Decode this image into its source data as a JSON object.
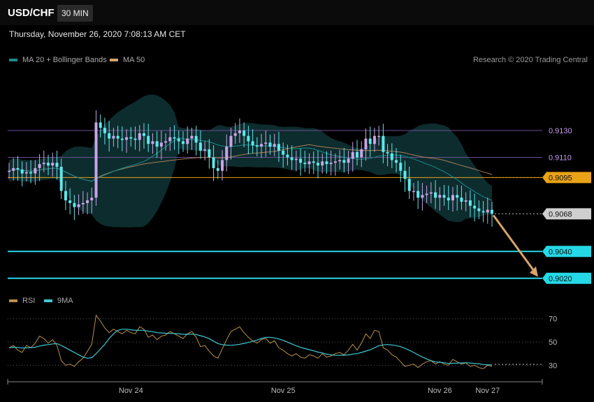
{
  "header": {
    "symbol": "USD/CHF",
    "timeframe": "30 MIN",
    "timestamp": "Thursday, November 26, 2020 7:08:13 AM CET"
  },
  "copyright": "Research © 2020 Trading Central",
  "colors": {
    "up": "#c9a5e6",
    "down": "#5ee8ec",
    "ma20": "#1a8a8c",
    "ma50": "#b8875a",
    "band_fill": "#0f3436",
    "resistance": "#6a4f93",
    "pivot": "#e8a317",
    "support": "#25d8e6",
    "arrow": "#d9a36a",
    "rsi": "#b88f4a",
    "rsi_ma": "#3fc9d6"
  },
  "chart_data": [
    {
      "type": "candlestick",
      "title": "USD/CHF",
      "legend": [
        {
          "name": "MA 20 + Bollinger Bands",
          "color": "#1a8a8c"
        },
        {
          "name": "MA 50",
          "color": "#d9a36a"
        }
      ],
      "legend_position": "top-left",
      "ylim": [
        0.901,
        0.917
      ],
      "x_ticks": [
        {
          "label": "Nov 24",
          "index": 28
        },
        {
          "label": "Nov 25",
          "index": 63
        },
        {
          "label": "Nov 26",
          "index": 99
        },
        {
          "label": "Nov 27",
          "index": 110
        }
      ],
      "levels": [
        {
          "label": "0.9130",
          "value": 0.913,
          "kind": "resistance"
        },
        {
          "label": "0.9110",
          "value": 0.911,
          "kind": "resistance"
        },
        {
          "label": "0.9095",
          "value": 0.9095,
          "kind": "pivot"
        },
        {
          "label": "0.9068",
          "value": 0.9068,
          "kind": "last"
        },
        {
          "label": "0.9040",
          "value": 0.904,
          "kind": "support"
        },
        {
          "label": "0.9020",
          "value": 0.902,
          "kind": "support"
        }
      ],
      "forecast_arrow": {
        "from": 0.9068,
        "to": 0.902
      },
      "close": [
        0.91,
        0.9102,
        0.9101,
        0.9098,
        0.9099,
        0.9098,
        0.9102,
        0.9105,
        0.9106,
        0.9104,
        0.9106,
        0.9103,
        0.9085,
        0.9078,
        0.9076,
        0.9073,
        0.9075,
        0.9076,
        0.9078,
        0.908,
        0.9136,
        0.9132,
        0.9128,
        0.9124,
        0.9126,
        0.9124,
        0.9123,
        0.9125,
        0.9124,
        0.9123,
        0.9128,
        0.9126,
        0.912,
        0.9122,
        0.9118,
        0.9121,
        0.9122,
        0.9125,
        0.9124,
        0.9122,
        0.912,
        0.9124,
        0.9126,
        0.9121,
        0.9115,
        0.9116,
        0.911,
        0.9102,
        0.91,
        0.9108,
        0.9118,
        0.9126,
        0.9128,
        0.913,
        0.9126,
        0.9122,
        0.9119,
        0.9118,
        0.912,
        0.9121,
        0.9118,
        0.912,
        0.9115,
        0.9112,
        0.911,
        0.9108,
        0.9109,
        0.9106,
        0.9105,
        0.9107,
        0.9106,
        0.9104,
        0.9107,
        0.9105,
        0.9106,
        0.9107,
        0.9108,
        0.9106,
        0.9109,
        0.9114,
        0.911,
        0.9116,
        0.9124,
        0.912,
        0.9126,
        0.9126,
        0.9114,
        0.9113,
        0.9108,
        0.9106,
        0.91,
        0.9094,
        0.9085,
        0.9085,
        0.908,
        0.9082,
        0.9083,
        0.9084,
        0.908,
        0.9082,
        0.908,
        0.9078,
        0.9082,
        0.908,
        0.9077,
        0.9078,
        0.9074,
        0.9072,
        0.907,
        0.9069,
        0.9071,
        0.9068
      ],
      "rsi": {
        "ylim": [
          20,
          80
        ],
        "y_ticks": [
          "70",
          "50",
          "30"
        ],
        "legend": [
          {
            "name": "RSI",
            "color": "#b88f4a"
          },
          {
            "name": "9MA",
            "color": "#3fc9d6"
          }
        ],
        "rsi": [
          45,
          47,
          43,
          41,
          47,
          45,
          49,
          55,
          53,
          49,
          52,
          47,
          34,
          30,
          31,
          29,
          33,
          36,
          42,
          48,
          73,
          68,
          62,
          58,
          61,
          59,
          57,
          60,
          58,
          57,
          63,
          61,
          54,
          56,
          52,
          55,
          56,
          59,
          57,
          55,
          53,
          57,
          59,
          54,
          46,
          47,
          42,
          38,
          36,
          44,
          52,
          59,
          61,
          63,
          58,
          54,
          51,
          49,
          52,
          53,
          49,
          51,
          45,
          43,
          40,
          38,
          40,
          37,
          36,
          39,
          38,
          36,
          40,
          37,
          38,
          40,
          41,
          39,
          43,
          48,
          43,
          49,
          57,
          53,
          60,
          59,
          45,
          43,
          39,
          37,
          33,
          29,
          30,
          31,
          28,
          31,
          33,
          34,
          31,
          33,
          31,
          30,
          35,
          33,
          31,
          32,
          29,
          30,
          28,
          27,
          30,
          29
        ],
        "ma": [
          45,
          45.5,
          45.3,
          44.8,
          45,
          45,
          45.5,
          46.5,
          47.3,
          47.7,
          48.3,
          48.6,
          47,
          45,
          43,
          41,
          39,
          37,
          36,
          36.5,
          40,
          44,
          48,
          53,
          57,
          60,
          61,
          61,
          60.5,
          60,
          60,
          60,
          59.3,
          58.8,
          58,
          57.8,
          57.5,
          57.4,
          57.3,
          57,
          56.6,
          56.6,
          56.8,
          56.4,
          55.4,
          54.3,
          52.8,
          50.7,
          48.6,
          47.7,
          47.3,
          47.2,
          47.5,
          48,
          48.8,
          49.6,
          50.5,
          51.7,
          53,
          54,
          54,
          53.5,
          52.6,
          51.4,
          49.9,
          48.3,
          46.7,
          45.4,
          44.3,
          43.4,
          42.4,
          41.3,
          40.6,
          39.5,
          39,
          38.5,
          38.6,
          38.6,
          38.9,
          39.6,
          40,
          41,
          42.2,
          43.3,
          45,
          46.8,
          47.5,
          47.8,
          47.5,
          46.9,
          45.9,
          44.6,
          42.8,
          41,
          38.9,
          37.1,
          35.4,
          34,
          32.8,
          32.6,
          32.1,
          31.6,
          31.7,
          31.8,
          32,
          32.1,
          31.9,
          31.6,
          31.2,
          30.6,
          30.4,
          30.2
        ]
      }
    }
  ]
}
